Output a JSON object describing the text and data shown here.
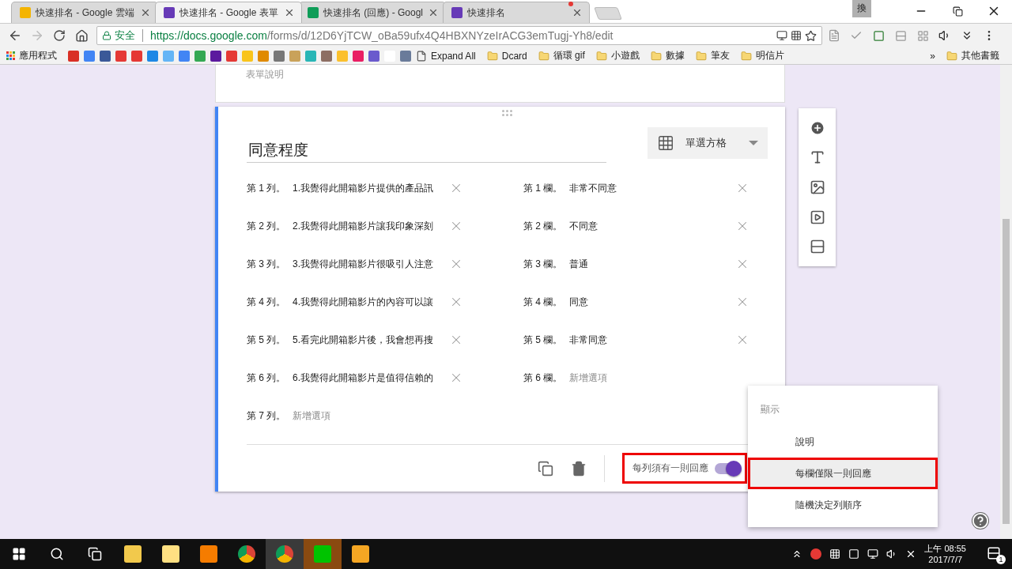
{
  "browser": {
    "tabs": [
      {
        "title": "快速排名 - Google 雲端",
        "kind": "drive",
        "selected": false,
        "alert": false
      },
      {
        "title": "快速排名 - Google 表單",
        "kind": "forms",
        "selected": true,
        "alert": false
      },
      {
        "title": "快速排名 (回應) - Googl",
        "kind": "sheets",
        "selected": false,
        "alert": false
      },
      {
        "title": "快速排名",
        "kind": "forms",
        "selected": false,
        "alert": true
      }
    ],
    "ime_label": "換",
    "address": {
      "secure_label": "安全",
      "host": "https://docs.google.com",
      "path": "/forms/d/12D6YjTCW_oBa59ufx4Q4HBXNYzeIrACG3emTugj-Yh8/edit"
    },
    "bookmarks": {
      "apps_label": "應用程式",
      "items": [
        {
          "label": "Expand All",
          "kind": "page"
        },
        {
          "label": "Dcard",
          "kind": "folder"
        },
        {
          "label": "循環 gif",
          "kind": "folder"
        },
        {
          "label": "小遊戲",
          "kind": "folder"
        },
        {
          "label": "數據",
          "kind": "folder"
        },
        {
          "label": "筆友",
          "kind": "folder"
        },
        {
          "label": "明信片",
          "kind": "folder"
        }
      ],
      "overflow": "»",
      "other": "其他書籤"
    }
  },
  "form": {
    "description_placeholder": "表單說明",
    "question": {
      "title": "同意程度",
      "type_label": "單選方格",
      "rows": [
        {
          "label": "第 1 列。",
          "text": "1.我覺得此開箱影片提供的產品訊",
          "kind": "option"
        },
        {
          "label": "第 2 列。",
          "text": "2.我覺得此開箱影片讓我印象深刻",
          "kind": "option"
        },
        {
          "label": "第 3 列。",
          "text": "3.我覺得此開箱影片很吸引人注意",
          "kind": "option"
        },
        {
          "label": "第 4 列。",
          "text": "4.我覺得此開箱影片的內容可以讓",
          "kind": "option"
        },
        {
          "label": "第 5 列。",
          "text": "5.看完此開箱影片後，我會想再搜",
          "kind": "option"
        },
        {
          "label": "第 6 列。",
          "text": "6.我覺得此開箱影片是值得信賴的",
          "kind": "option"
        },
        {
          "label": "第 7 列。",
          "text": "新增選項",
          "kind": "add"
        }
      ],
      "columns": [
        {
          "label": "第 1 欄。",
          "text": "非常不同意",
          "kind": "option"
        },
        {
          "label": "第 2 欄。",
          "text": "不同意",
          "kind": "option"
        },
        {
          "label": "第 3 欄。",
          "text": "普通",
          "kind": "option"
        },
        {
          "label": "第 4 欄。",
          "text": "同意",
          "kind": "option"
        },
        {
          "label": "第 5 欄。",
          "text": "非常同意",
          "kind": "option"
        },
        {
          "label": "第 6 欄。",
          "text": "新增選項",
          "kind": "add"
        }
      ],
      "required_label": "每列須有一則回應",
      "required_on": true,
      "required_highlighted": true
    }
  },
  "menu": {
    "header": "顯示",
    "items": [
      {
        "label": "說明",
        "hovered": false,
        "highlighted": false
      },
      {
        "label": "每欄僅限一則回應",
        "hovered": true,
        "highlighted": true
      },
      {
        "label": "隨機決定列順序",
        "hovered": false,
        "highlighted": false
      }
    ]
  },
  "taskbar": {
    "time": "上午 08:55",
    "date": "2017/7/7",
    "notifications": "1"
  }
}
